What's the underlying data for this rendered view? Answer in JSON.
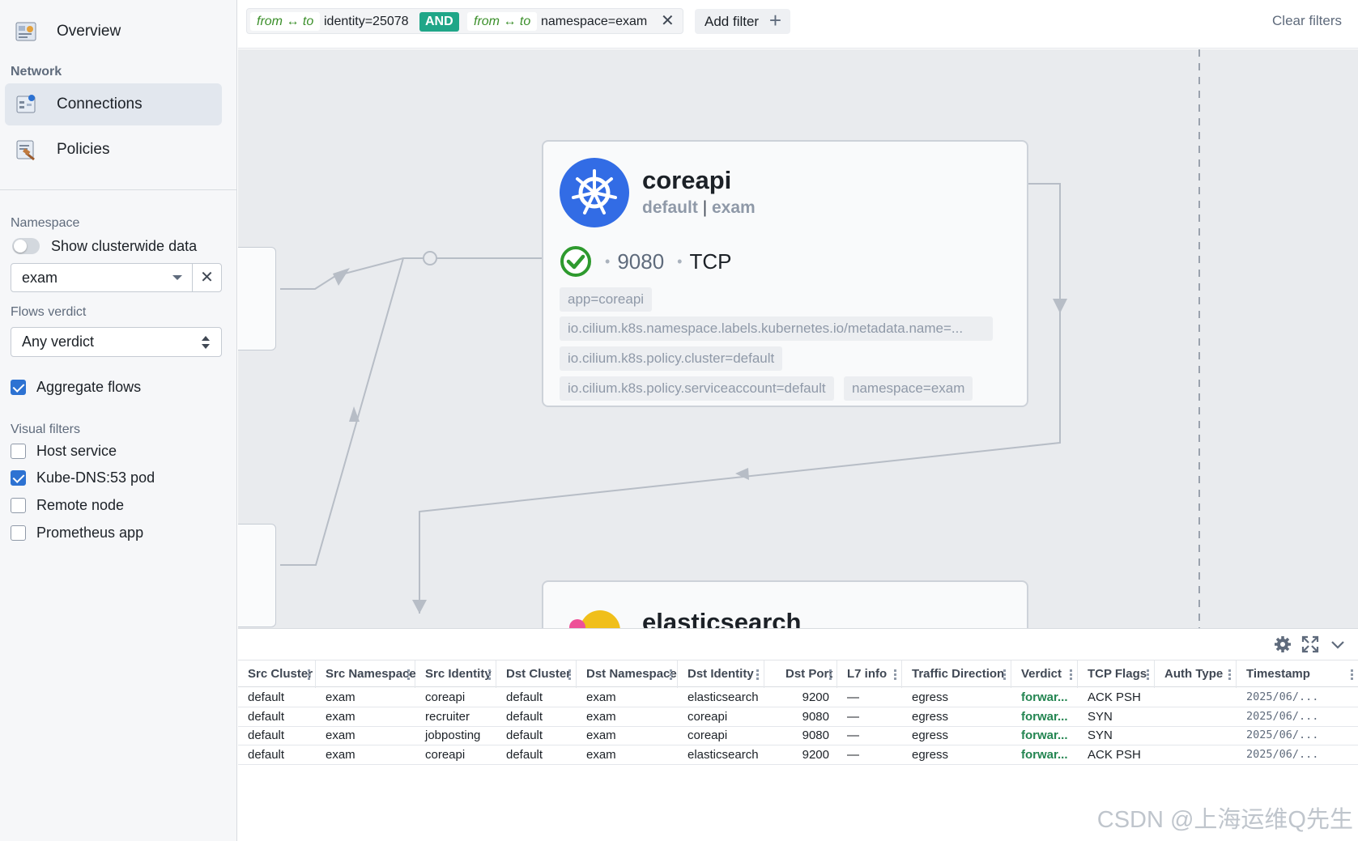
{
  "sidebar": {
    "overview_label": "Overview",
    "network_section": "Network",
    "connections_label": "Connections",
    "policies_label": "Policies",
    "namespace_section": "Namespace",
    "clusterwide_label": "Show clusterwide data",
    "clusterwide_on": false,
    "namespace_value": "exam",
    "namespace_clear": "✕",
    "verdict_section": "Flows verdict",
    "verdict_value": "Any verdict",
    "aggregate_label": "Aggregate flows",
    "aggregate_checked": true,
    "visual_section": "Visual filters",
    "visual_filters": [
      {
        "label": "Host service",
        "checked": false
      },
      {
        "label": "Kube-DNS:53 pod",
        "checked": true
      },
      {
        "label": "Remote node",
        "checked": false
      },
      {
        "label": "Prometheus app",
        "checked": false
      }
    ]
  },
  "filterbar": {
    "filter1_dir": "from ↔ to",
    "filter1_value": "identity=25078",
    "and_label": "AND",
    "filter2_dir": "from ↔ to",
    "filter2_value": "namespace=exam",
    "remove_icon": "✕",
    "add_filter_label": "Add filter",
    "add_icon": "+",
    "clear_filters_label": "Clear filters"
  },
  "canvas": {
    "main_card": {
      "title": "coreapi",
      "cluster": "default",
      "separator": "|",
      "namespace": "exam",
      "port_dot": "•",
      "port": "9080",
      "protocol": "TCP",
      "labels": [
        "app=coreapi",
        "io.cilium.k8s.namespace.labels.kubernetes.io/metadata.name=...",
        "io.cilium.k8s.policy.cluster=default",
        "io.cilium.k8s.policy.serviceaccount=default",
        "namespace=exam"
      ]
    },
    "second_card": {
      "title": "elasticsearch"
    }
  },
  "table": {
    "columns": [
      "Src Cluster",
      "Src Namespace",
      "Src Identity",
      "Dst Cluster",
      "Dst Namespace",
      "Dst Identity",
      "Dst Port",
      "L7 info",
      "Traffic Direction",
      "Verdict",
      "TCP Flags",
      "Auth Type",
      "Timestamp"
    ],
    "rows": [
      [
        "default",
        "exam",
        "coreapi",
        "default",
        "exam",
        "elasticsearch",
        "9200",
        "—",
        "egress",
        "forwar...",
        "ACK PSH",
        "",
        "2025/06/..."
      ],
      [
        "default",
        "exam",
        "recruiter",
        "default",
        "exam",
        "coreapi",
        "9080",
        "—",
        "egress",
        "forwar...",
        "SYN",
        "",
        "2025/06/..."
      ],
      [
        "default",
        "exam",
        "jobposting",
        "default",
        "exam",
        "coreapi",
        "9080",
        "—",
        "egress",
        "forwar...",
        "SYN",
        "",
        "2025/06/..."
      ],
      [
        "default",
        "exam",
        "coreapi",
        "default",
        "exam",
        "elasticsearch",
        "9200",
        "—",
        "egress",
        "forwar...",
        "ACK PSH",
        "",
        "2025/06/..."
      ]
    ]
  },
  "watermark": "CSDN @上海运维Q先生",
  "colors": {
    "accent": "#2d72d2",
    "and_chip": "#1fa688",
    "forwarded": "#238551",
    "k8s_blue": "#326ce5"
  }
}
